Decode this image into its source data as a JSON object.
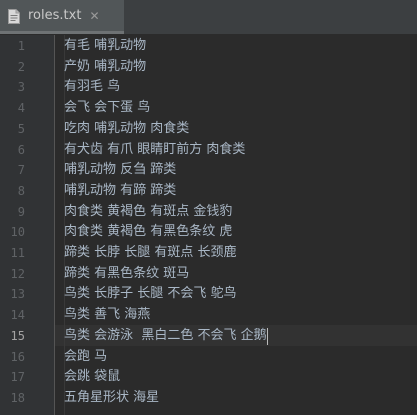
{
  "tab": {
    "filename": "roles.txt",
    "icon": "text-file-icon",
    "close_icon": "close-icon"
  },
  "editor": {
    "current_line": 15,
    "lines": [
      {
        "num": "1",
        "text": "有毛 哺乳动物"
      },
      {
        "num": "2",
        "text": "产奶 哺乳动物"
      },
      {
        "num": "3",
        "text": "有羽毛 鸟"
      },
      {
        "num": "4",
        "text": "会飞 会下蛋 鸟"
      },
      {
        "num": "5",
        "text": "吃肉 哺乳动物 肉食类"
      },
      {
        "num": "6",
        "text": "有犬齿 有爪 眼睛盯前方 肉食类"
      },
      {
        "num": "7",
        "text": "哺乳动物 反刍 蹄类"
      },
      {
        "num": "8",
        "text": "哺乳动物 有蹄 蹄类"
      },
      {
        "num": "9",
        "text": "肉食类 黄褐色 有斑点 金钱豹"
      },
      {
        "num": "10",
        "text": "肉食类 黄褐色 有黑色条纹 虎"
      },
      {
        "num": "11",
        "text": "蹄类 长脖 长腿 有斑点 长颈鹿"
      },
      {
        "num": "12",
        "text": "蹄类 有黑色条纹 斑马"
      },
      {
        "num": "13",
        "text": "鸟类 长脖子 长腿 不会飞 鸵鸟"
      },
      {
        "num": "14",
        "text": "鸟类 善飞 海燕"
      },
      {
        "num": "15",
        "text": "鸟类 会游泳  黑白二色 不会飞 企鹅"
      },
      {
        "num": "16",
        "text": "会跑 马"
      },
      {
        "num": "17",
        "text": "会跳 袋鼠"
      },
      {
        "num": "18",
        "text": "五角星形状 海星"
      }
    ]
  }
}
